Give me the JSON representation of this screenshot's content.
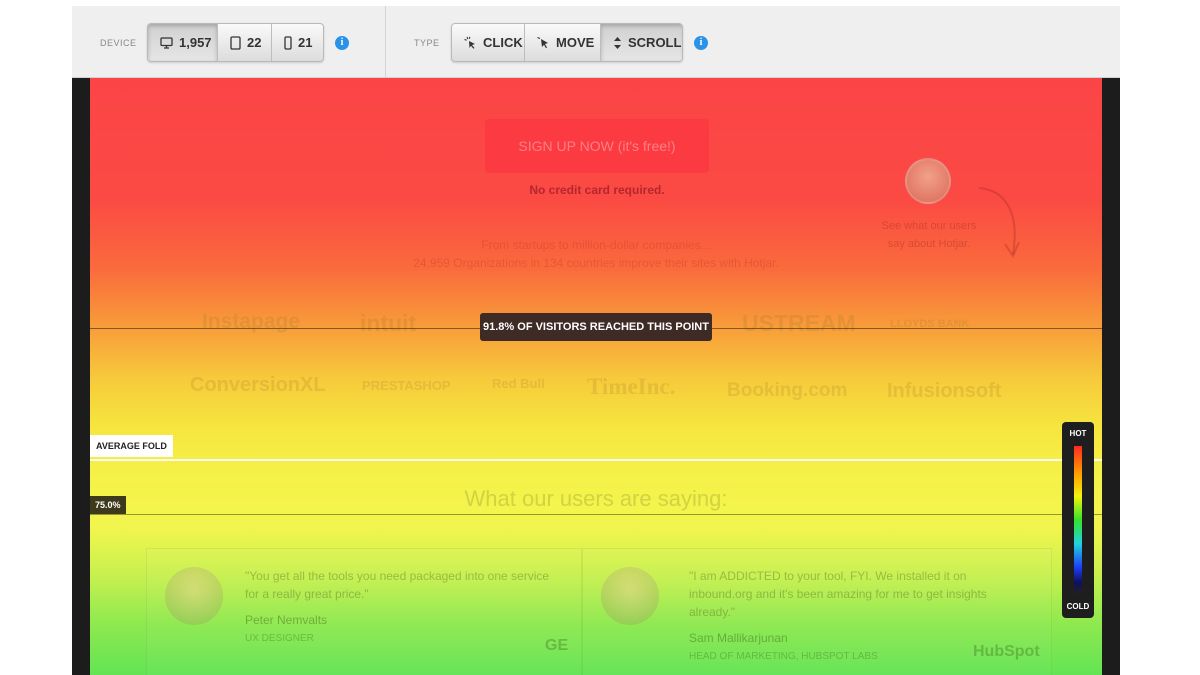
{
  "toolbar": {
    "device_label": "DEVICE",
    "type_label": "TYPE",
    "devices": [
      {
        "name": "desktop",
        "count": "1,957",
        "active": true
      },
      {
        "name": "tablet",
        "count": "22",
        "active": false
      },
      {
        "name": "mobile",
        "count": "21",
        "active": false
      }
    ],
    "types": [
      {
        "name": "click",
        "label": "CLICK",
        "active": false
      },
      {
        "name": "move",
        "label": "MOVE",
        "active": false
      },
      {
        "name": "scroll",
        "label": "SCROLL",
        "active": true
      }
    ],
    "info_glyph": "i"
  },
  "page": {
    "signup_button": "SIGN UP NOW (it's free!)",
    "no_credit_card": "No credit card required.",
    "testimonial_cta_line1": "See what our users",
    "testimonial_cta_line2": "say about Hotjar.",
    "org_line1": "From startups to million-dollar companies...",
    "org_line2": "24,959 Organizations in 134 countries improve their sites with Hotjar.",
    "logos_row1": [
      "Instapage",
      "intuit",
      "USTREAM",
      "LLOYDS BANK"
    ],
    "logos_row2": [
      "ConversionXL",
      "PRESTASHOP",
      "Red Bull",
      "TimeInc.",
      "Booking.com",
      "Infusionsoft"
    ],
    "reviews_title": "What our users are saying:",
    "reviews": [
      {
        "quote": "\"You get all the tools you need packaged into one service for a really great price.\"",
        "name": "Peter Nemvalts",
        "role": "UX DESIGNER",
        "logo": "GE"
      },
      {
        "quote": "\"I am ADDICTED to your tool, FYI. We installed it on inbound.org and it's been amazing for me to get insights already.\"",
        "name": "Sam Mallikarjunan",
        "role": "HEAD OF MARKETING, HUBSPOT LABS",
        "logo": "HubSpot"
      }
    ]
  },
  "overlays": {
    "reached_label": "91.8% OF VISITORS REACHED THIS POINT",
    "average_fold_label": "AVERAGE FOLD",
    "percent_label": "75.0%"
  },
  "legend": {
    "hot": "HOT",
    "cold": "COLD"
  },
  "colors": {
    "info_blue": "#2a93e8",
    "hot_red": "#fb4446",
    "warm_yellow": "#f5f249",
    "cool_green": "#63e454"
  }
}
